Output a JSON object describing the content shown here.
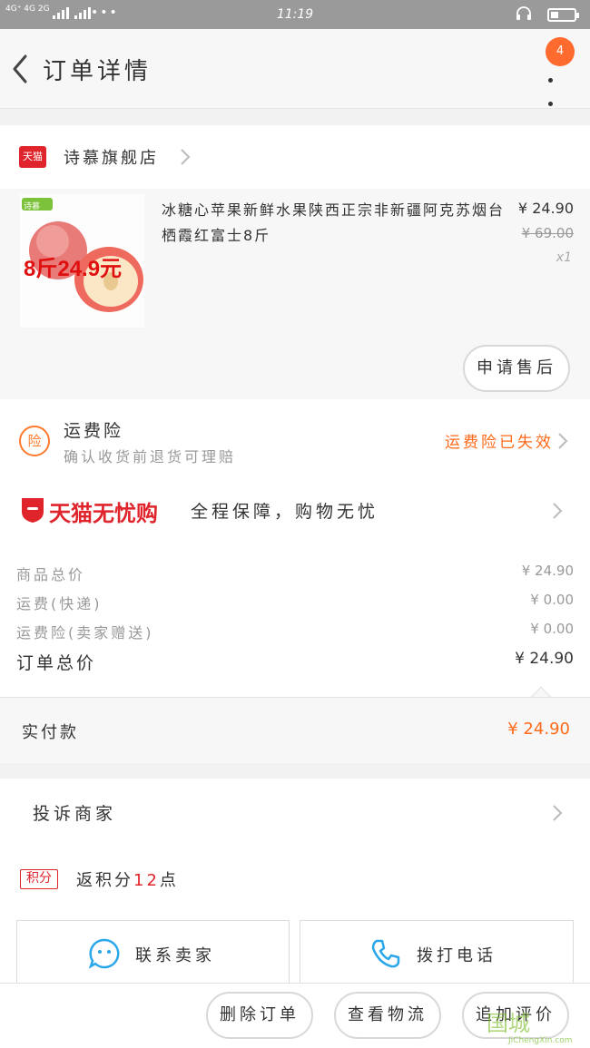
{
  "status_bar": {
    "network": "4G⁺ 4G 2G",
    "time": "11:19",
    "more": "•••"
  },
  "header": {
    "title": "订单详情",
    "notification_count": "4"
  },
  "store": {
    "logo_text": "天猫",
    "name": "诗慕旗舰店"
  },
  "product": {
    "image_tag": "诗慕",
    "image_caption": "8斤24.9元",
    "name": "冰糖心苹果新鲜水果陕西正宗非新疆阿克苏烟台栖霞红富士8斤",
    "price": "¥ 24.90",
    "original_price": "¥ 69.00",
    "quantity": "x1",
    "aftersale_label": "申请售后"
  },
  "insurance": {
    "icon_text": "险",
    "title": "运费险",
    "subtitle": "确认收货前退货可理赔",
    "status": "运费险已失效"
  },
  "guarantee": {
    "brand": "天猫无忧购",
    "description": "全程保障，购物无忧"
  },
  "summary": {
    "rows": [
      {
        "label": "商品总价",
        "value": "¥ 24.90"
      },
      {
        "label": "运费(快递)",
        "value": "¥ 0.00"
      },
      {
        "label": "运费险(卖家赠送)",
        "value": "¥ 0.00"
      }
    ],
    "total_label": "订单总价",
    "total_value": "¥ 24.90",
    "paid_label": "实付款",
    "paid_value": "¥ 24.90"
  },
  "complain": {
    "label": "投诉商家"
  },
  "points": {
    "badge": "积分",
    "prefix": "返积分",
    "amount": "12",
    "suffix": "点"
  },
  "contact": {
    "seller_label": "联系卖家",
    "phone_label": "拨打电话"
  },
  "bottom_bar": {
    "delete_label": "删除订单",
    "logistics_label": "查看物流",
    "review_label": "追加评价"
  },
  "watermark": {
    "logo": "国城",
    "text": "JiChengXin.com"
  },
  "colors": {
    "accent": "#ff6a1a",
    "tmall_red": "#e0242c",
    "status_bar": "#9a9a9a"
  }
}
